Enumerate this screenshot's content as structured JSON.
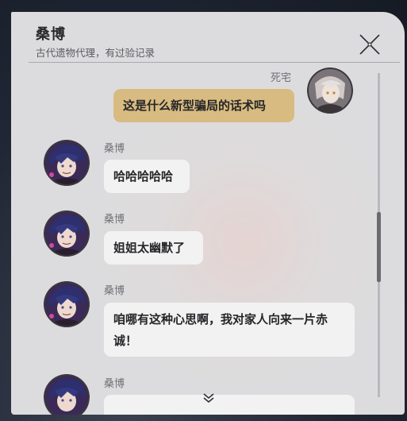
{
  "dialog": {
    "title": "桑博",
    "subtitle": "古代遗物代理，有过验记录"
  },
  "messages": [
    {
      "sender": "死宅",
      "text": "这是什么新型骗局的话术吗",
      "self": true
    },
    {
      "sender": "桑博",
      "text": "哈哈哈哈哈",
      "self": false
    },
    {
      "sender": "桑博",
      "text": "姐姐太幽默了",
      "self": false
    },
    {
      "sender": "桑博",
      "text": "咱哪有这种心思啊，我对家人向来一片赤诚！",
      "self": false
    },
    {
      "sender": "桑博",
      "text": "",
      "self": false
    }
  ],
  "icons": {
    "close": "close-icon",
    "scroll_down": "chevron-down-icon"
  },
  "colors": {
    "self_bubble": "#d8bb80",
    "other_bubble": "#f2f2f3",
    "panel": "#dcdcde"
  }
}
